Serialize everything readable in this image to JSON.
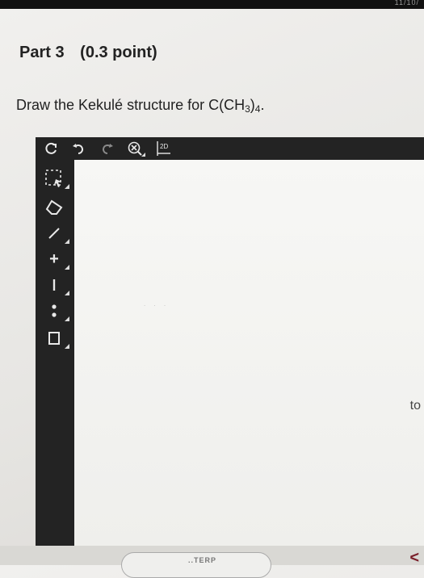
{
  "system_bar": {
    "date_text": "11/10/"
  },
  "part": {
    "title": "Part 3",
    "points": "(0.3 point)"
  },
  "question": {
    "prefix": "Draw the Kekulé structure for C(CH",
    "sub1": "3",
    "mid": ")",
    "sub2": "4",
    "suffix": "."
  },
  "editor": {
    "top_tools": [
      "refresh-icon",
      "undo-icon",
      "redo-icon",
      "zoom-clear-icon",
      "2d-template-icon"
    ],
    "template_label": "2D",
    "left_tools": [
      "select-lasso-icon",
      "eraser-icon",
      "bond-line-icon",
      "add-atom-icon",
      "minus-charge-icon",
      "lone-pair-icon",
      "rectangle-icon"
    ],
    "add_label": "+",
    "minus_label": "−",
    "side_text": "to"
  },
  "footer": {
    "button_label": "..TERP"
  },
  "colors": {
    "toolbar": "#232323",
    "canvas": "#f4f4f2",
    "back_arrow": "#7a1f2a"
  }
}
